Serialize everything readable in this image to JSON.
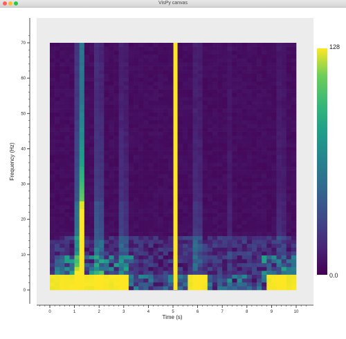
{
  "window": {
    "title": "VisPy canvas"
  },
  "colors": {
    "titlebar": "#dcdcdc",
    "plot_background": "#ececec"
  },
  "chart_data": {
    "type": "heatmap",
    "title": "",
    "xlabel": "Time (s)",
    "ylabel": "Frequency (Hz)",
    "xlim": [
      0,
      10
    ],
    "ylim": [
      0,
      70
    ],
    "x_ticks": [
      "0",
      "1",
      "2",
      "3",
      "4",
      "5",
      "6",
      "7",
      "8",
      "9",
      "10"
    ],
    "y_ticks": [
      "0",
      "10",
      "20",
      "30",
      "40",
      "50",
      "60",
      "70"
    ],
    "colorbar": {
      "min_label": "0.0",
      "max_label": "128",
      "colormap": "viridis"
    },
    "grid": false
  }
}
